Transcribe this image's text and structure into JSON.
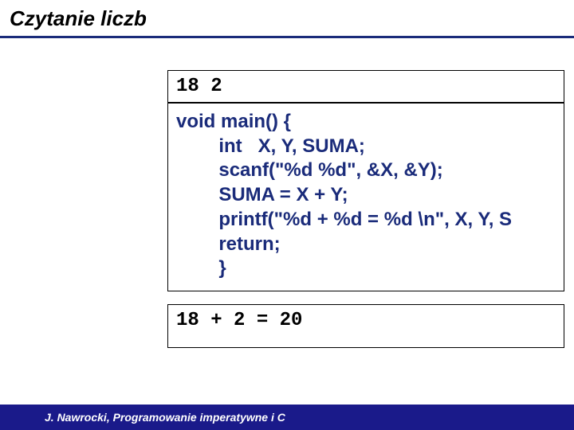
{
  "slide": {
    "title": "Czytanie liczb"
  },
  "input_box": {
    "text": "18 2"
  },
  "code": {
    "lines": [
      "void main() {",
      "        int   X, Y, SUMA;",
      "",
      "        scanf(\"%d %d\", &X, &Y);",
      "        SUMA = X + Y;",
      "        printf(\"%d + %d = %d \\n\", X, Y, S",
      "        return;",
      "        }"
    ]
  },
  "output_box": {
    "text": "18 + 2 = 20"
  },
  "footer": {
    "text": "J. Nawrocki, Programowanie imperatywne i C"
  }
}
